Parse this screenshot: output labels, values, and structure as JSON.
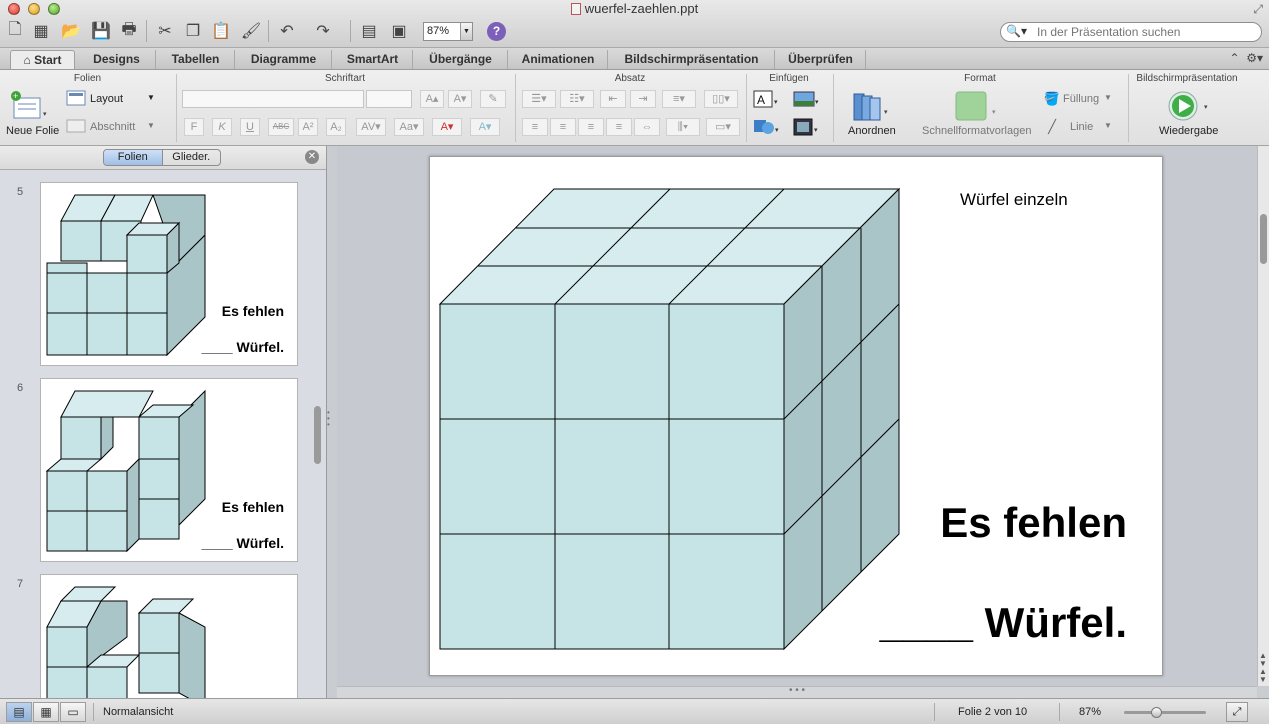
{
  "window": {
    "title": "wuerfel-zaehlen.ppt",
    "zoom": "87%",
    "help": "?"
  },
  "search": {
    "placeholder": "In der Präsentation suchen"
  },
  "tabs": [
    {
      "label": "Start"
    },
    {
      "label": "Designs"
    },
    {
      "label": "Tabellen"
    },
    {
      "label": "Diagramme"
    },
    {
      "label": "SmartArt"
    },
    {
      "label": "Übergänge"
    },
    {
      "label": "Animationen"
    },
    {
      "label": "Bildschirmpräsentation"
    },
    {
      "label": "Überprüfen"
    }
  ],
  "ribbon": {
    "groups": {
      "folien": "Folien",
      "schriftart": "Schriftart",
      "absatz": "Absatz",
      "einfuegen": "Einfügen",
      "format": "Format",
      "bildschirm": "Bildschirmpräsentation"
    },
    "neue_folie": "Neue Folie",
    "layout": "Layout",
    "abschnitt": "Abschnitt",
    "font_glyphs": {
      "bold": "F",
      "italic": "K",
      "underline": "U",
      "strike": "ABC",
      "superscript": "A²",
      "subscript": "A₂"
    },
    "anordnen": "Anordnen",
    "schnellformatvorlagen": "Schnellformatvorlagen",
    "fuellung": "Füllung",
    "linie": "Linie",
    "wiedergabe": "Wiedergabe"
  },
  "slide_pane": {
    "seg_folien": "Folien",
    "seg_gliederung": "Glieder.",
    "thumbnails": [
      {
        "number": "5",
        "line1": "Es fehlen",
        "line2": "____ Würfel."
      },
      {
        "number": "6",
        "line1": "Es fehlen",
        "line2": "____ Würfel."
      },
      {
        "number": "7",
        "line1": "",
        "line2": ""
      }
    ]
  },
  "slide": {
    "subtitle": "Würfel einzeln",
    "line1": "Es fehlen",
    "line2": "____ Würfel."
  },
  "status": {
    "view": "Normalansicht",
    "slide_counter": "Folie 2 von 10",
    "zoom": "87%",
    "zoom_level": 0.4
  },
  "colors": {
    "cube_front": "#c6e3e6",
    "cube_top": "#d6ecef",
    "cube_side": "#a9c5c7",
    "accent": "#9fbfe8"
  }
}
